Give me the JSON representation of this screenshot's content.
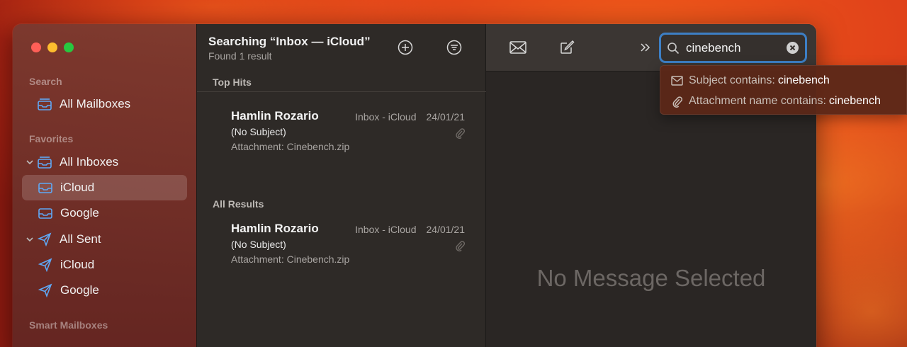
{
  "window": {
    "traffic_lights": [
      "close",
      "minimize",
      "zoom"
    ]
  },
  "sidebar": {
    "sections": {
      "search": "Search",
      "favorites": "Favorites",
      "smart": "Smart Mailboxes"
    },
    "items": [
      {
        "label": "All Mailboxes",
        "icon": "tray-stack-icon"
      },
      {
        "label": "All Inboxes",
        "icon": "tray-stack-icon"
      },
      {
        "label": "iCloud",
        "icon": "tray-icon",
        "selected": true
      },
      {
        "label": "Google",
        "icon": "tray-icon"
      },
      {
        "label": "All Sent",
        "icon": "paperplane-icon"
      },
      {
        "label": "iCloud",
        "icon": "paperplane-icon"
      },
      {
        "label": "Google",
        "icon": "paperplane-icon"
      }
    ]
  },
  "list": {
    "title": "Searching “Inbox — iCloud”",
    "subtitle": "Found 1 result",
    "top_hits_label": "Top Hits",
    "all_results_label": "All Results",
    "messages": [
      {
        "from": "Hamlin Rozario",
        "mailbox": "Inbox - iCloud",
        "date": "24/01/21",
        "subject": "(No Subject)",
        "attachment": "Attachment: Cinebench.zip"
      },
      {
        "from": "Hamlin Rozario",
        "mailbox": "Inbox - iCloud",
        "date": "24/01/21",
        "subject": "(No Subject)",
        "attachment": "Attachment: Cinebench.zip"
      }
    ]
  },
  "viewer": {
    "empty_text": "No Message Selected"
  },
  "search": {
    "value": "cinebench",
    "suggestions": [
      {
        "prefix": "Subject contains:",
        "term": "cinebench",
        "icon": "envelope-icon"
      },
      {
        "prefix": "Attachment name contains:",
        "term": "cinebench",
        "icon": "paperclip-icon"
      }
    ]
  },
  "colors": {
    "accent": "#5fa8f5",
    "search_focus": "#3d7fc5"
  }
}
